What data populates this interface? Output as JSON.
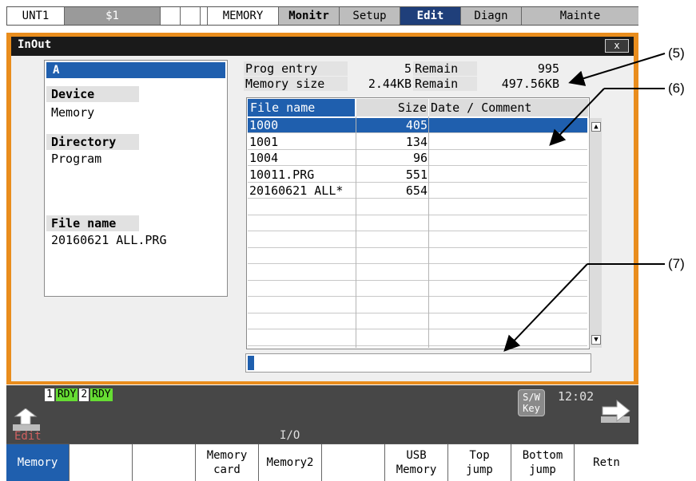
{
  "topbar": {
    "unit": "UNT1",
    "sys": "$1",
    "mode": "MEMORY",
    "tabs": [
      "Monitr",
      "Setup",
      "Edit",
      "Diagn",
      "Mainte"
    ],
    "active_tab": "Edit"
  },
  "window": {
    "title": "InOut",
    "close": "x"
  },
  "left_panel": {
    "header": "A",
    "device_label": "Device",
    "device_value": "Memory",
    "directory_label": "Directory",
    "directory_value": "Program",
    "filename_label": "File name",
    "filename_value": "20160621 ALL.PRG"
  },
  "summary": {
    "prog_entry_label": "Prog entry",
    "prog_entry_value": "5",
    "remain_label_1": "Remain",
    "remain_value_1": "995",
    "memory_size_label": "Memory size",
    "memory_size_value": "2.44KB",
    "remain_label_2": "Remain",
    "remain_value_2": "497.56KB"
  },
  "table": {
    "headers": [
      "File name",
      "Size",
      "Date / Comment"
    ],
    "rows": [
      {
        "name": "1000",
        "size": "405",
        "comment": ""
      },
      {
        "name": "1001",
        "size": "134",
        "comment": ""
      },
      {
        "name": "1004",
        "size": "96",
        "comment": ""
      },
      {
        "name": "10011.PRG",
        "size": "551",
        "comment": ""
      },
      {
        "name": "20160621 ALL*",
        "size": "654",
        "comment": ""
      }
    ],
    "selected_row": 0
  },
  "annotations": {
    "a5": "(5)",
    "a6": "(6)",
    "a7": "(7)"
  },
  "status": {
    "rdy1_num": "1",
    "rdy1": "RDY",
    "rdy2_num": "2",
    "rdy2": "RDY",
    "mode_label": "Edit",
    "screen_label": "I/O",
    "time": "12:02",
    "sw_key": "S/W\nKey"
  },
  "softkeys": [
    "Memory",
    "",
    "",
    "Memory\ncard",
    "Memory2",
    "",
    "USB\nMemory",
    "Top\njump",
    "Bottom\njump",
    "Retn"
  ],
  "colors": {
    "frame": "#e98d1d",
    "accent": "#1f5fae",
    "rdy": "#66dd33"
  }
}
